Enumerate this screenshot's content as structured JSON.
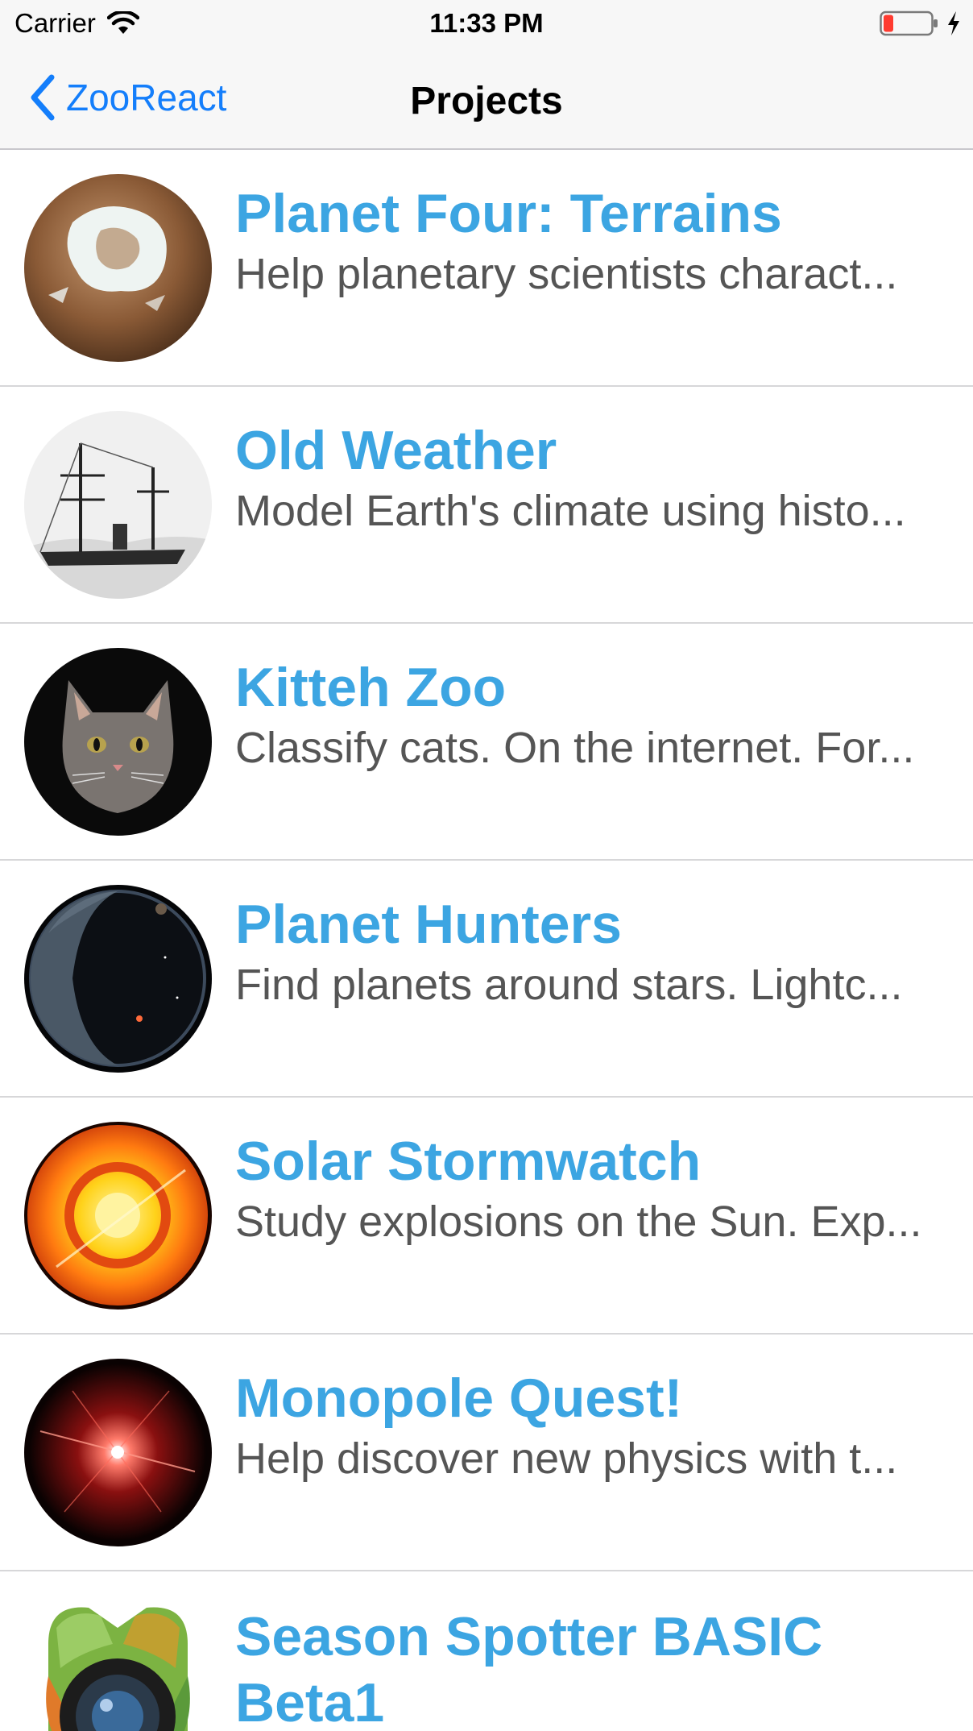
{
  "status_bar": {
    "carrier": "Carrier",
    "time": "11:33 PM",
    "battery_color": "#ff3b30"
  },
  "nav": {
    "back_label": "ZooReact",
    "title": "Projects",
    "accent_color": "#147efb"
  },
  "title_color": "#3ca5e2",
  "projects": [
    {
      "title": "Planet Four: Terrains",
      "description": "Help planetary scientists charact...",
      "icon": "mars-terrain-thumbnail"
    },
    {
      "title": "Old Weather",
      "description": "Model Earth's climate using histo...",
      "icon": "sailing-ship-thumbnail"
    },
    {
      "title": "Kitteh Zoo",
      "description": "Classify cats. On the internet. For...",
      "icon": "cat-thumbnail"
    },
    {
      "title": "Planet Hunters",
      "description": "Find planets around stars. Lightc...",
      "icon": "planet-thumbnail"
    },
    {
      "title": "Solar Stormwatch",
      "description": "Study explosions on the Sun. Exp...",
      "icon": "sun-thumbnail"
    },
    {
      "title": "Monopole Quest!",
      "description": "Help discover new physics with t...",
      "icon": "particle-burst-thumbnail"
    },
    {
      "title": "Season Spotter BASIC Beta1",
      "description": "",
      "icon": "camera-leaves-thumbnail"
    }
  ]
}
